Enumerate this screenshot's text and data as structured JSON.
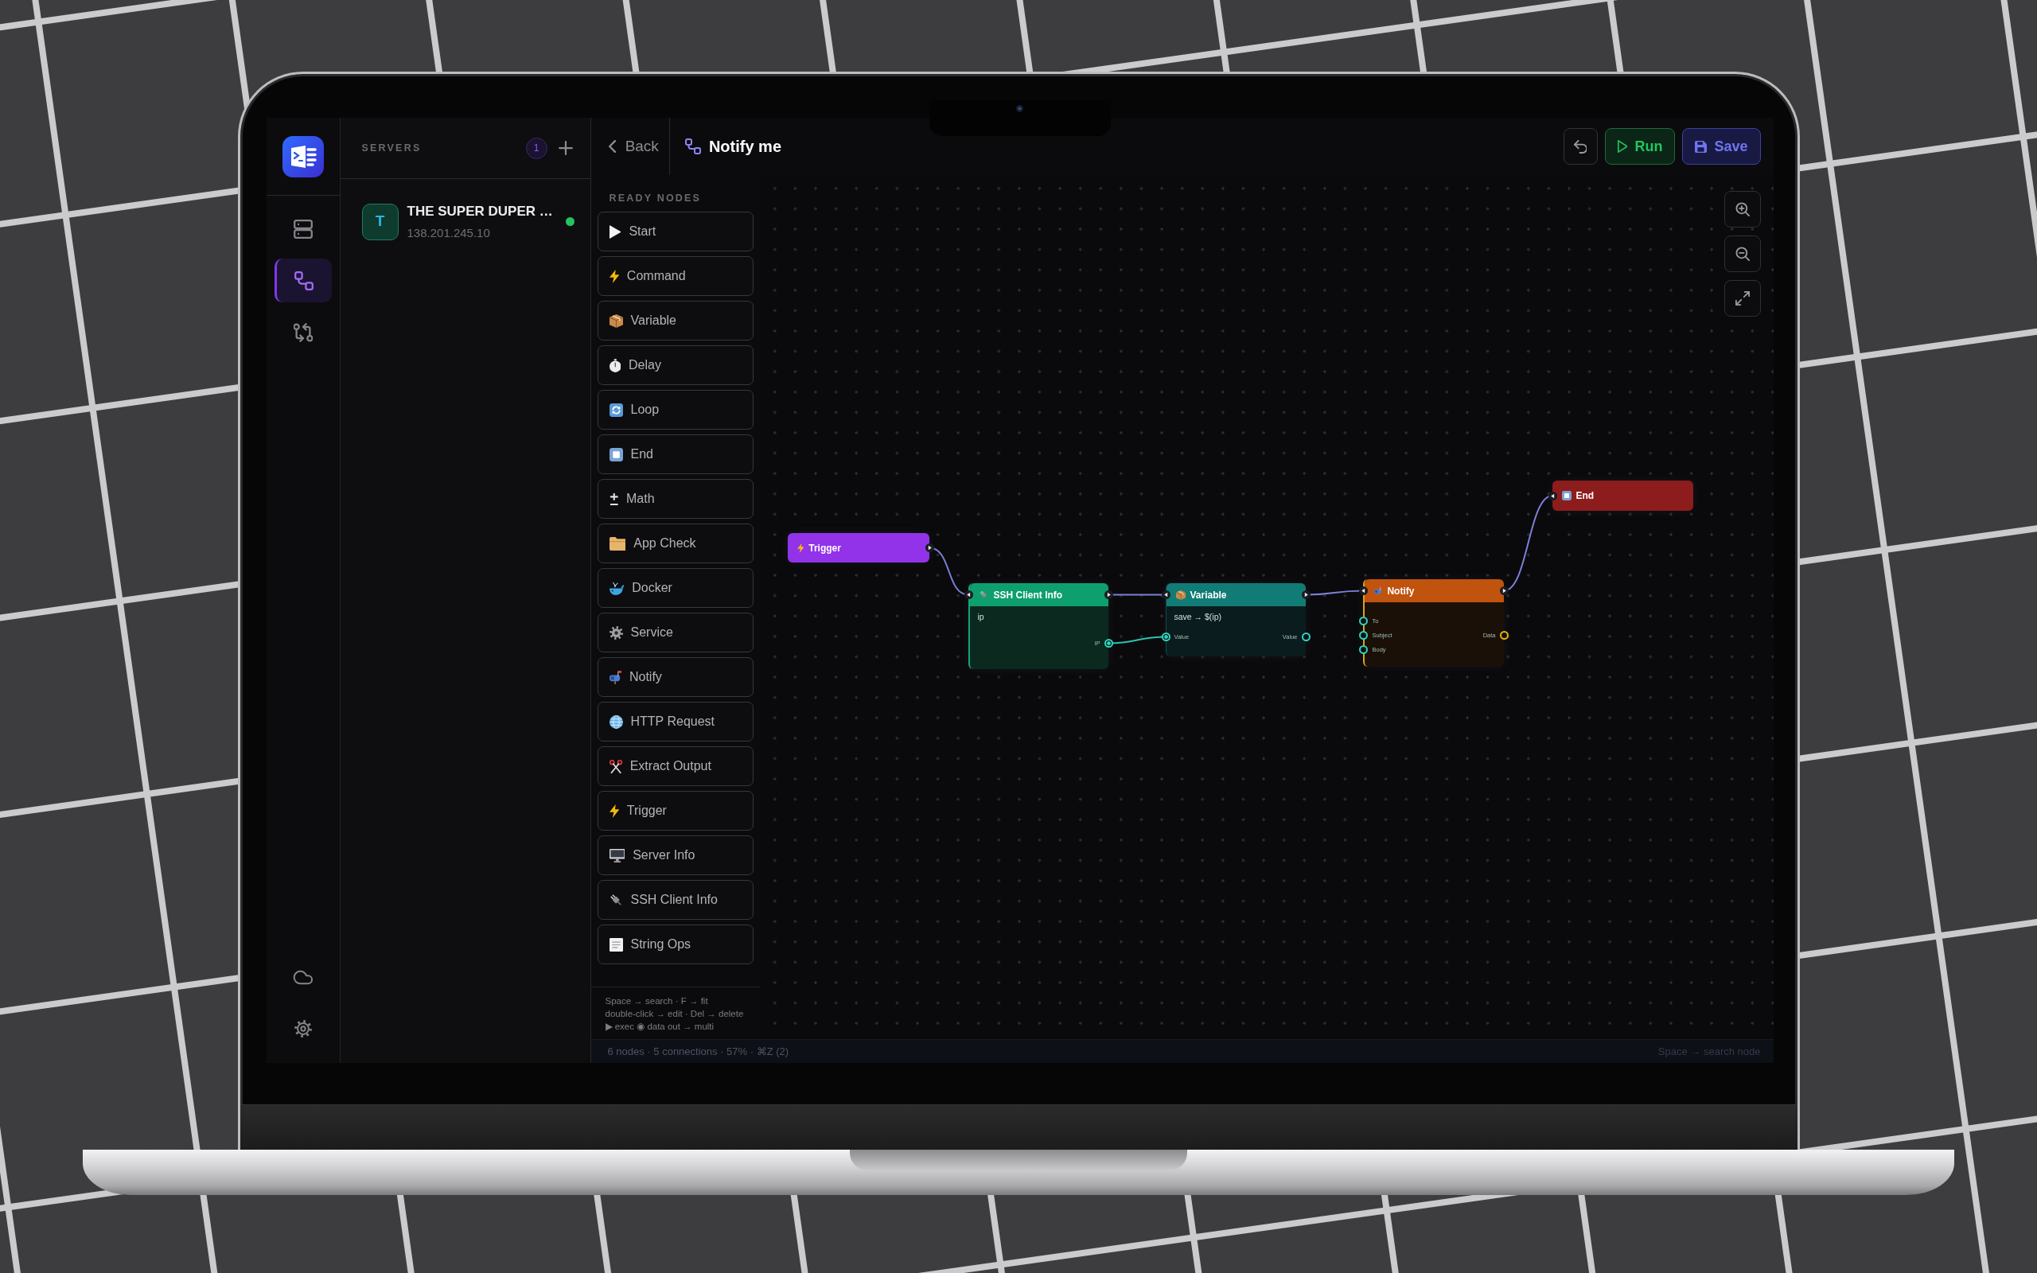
{
  "rail": {
    "items": [
      {
        "kind": "servers",
        "selected": false
      },
      {
        "kind": "workflows",
        "selected": true
      },
      {
        "kind": "compare",
        "selected": false
      }
    ]
  },
  "servers": {
    "title": "SERVERS",
    "count": "1",
    "items": [
      {
        "avatar": "T",
        "name": "THE SUPER DUPER …",
        "ip": "138.201.245.10",
        "online": true
      }
    ]
  },
  "header": {
    "back": "Back",
    "title": "Notify me"
  },
  "toolbar": [
    {
      "kind": "undo"
    },
    {
      "kind": "run",
      "label": "Run"
    },
    {
      "kind": "save",
      "label": "Save"
    }
  ],
  "ready_nodes": {
    "title": "READY NODES",
    "items": [
      {
        "kind": "play",
        "label": "Start"
      },
      {
        "kind": "bolt",
        "label": "Command"
      },
      {
        "kind": "package",
        "label": "Variable"
      },
      {
        "kind": "stopwatch",
        "label": "Delay"
      },
      {
        "kind": "loop",
        "label": "Loop"
      },
      {
        "kind": "stop",
        "label": "End"
      },
      {
        "kind": "plusminus",
        "label": "Math"
      },
      {
        "kind": "folder",
        "label": "App Check"
      },
      {
        "kind": "whale",
        "label": "Docker"
      },
      {
        "kind": "gear",
        "label": "Service"
      },
      {
        "kind": "mailbox",
        "label": "Notify"
      },
      {
        "kind": "globe",
        "label": "HTTP Request"
      },
      {
        "kind": "scissors",
        "label": "Extract Output"
      },
      {
        "kind": "bolt",
        "label": "Trigger"
      },
      {
        "kind": "monitor",
        "label": "Server Info"
      },
      {
        "kind": "plug",
        "label": "SSH Client Info"
      },
      {
        "kind": "memo",
        "label": "String Ops"
      }
    ],
    "hints": [
      "Space → search · F → fit",
      "double-click → edit · Del → delete",
      "▶ exec ◉ data out → multi"
    ]
  },
  "canvas": {
    "nodes": [
      {
        "kind": "trigger",
        "title": "Trigger"
      },
      {
        "kind": "ssh",
        "title": "SSH Client Info",
        "text": "ip",
        "outputs": [
          {
            "label": "IP",
            "color": "#2dd4bf",
            "connected": true
          }
        ]
      },
      {
        "kind": "variable",
        "title": "Variable",
        "text": "save → $(ip)",
        "inputs": [
          {
            "label": "Value",
            "color": "#2dd4bf",
            "connected": true
          }
        ],
        "outputs": [
          {
            "label": "Value",
            "color": "#2dd4bf",
            "connected": false
          }
        ]
      },
      {
        "kind": "notify",
        "title": "Notify",
        "inputs": [
          {
            "label": "To",
            "color": "#2dd4bf",
            "connected": false
          },
          {
            "label": "Subject",
            "color": "#2dd4bf",
            "connected": false
          },
          {
            "label": "Body",
            "color": "#2dd4bf",
            "connected": false
          }
        ],
        "outputs": [
          {
            "label": "Data",
            "color": "#eab308",
            "connected": false
          }
        ]
      },
      {
        "kind": "end",
        "title": "End"
      }
    ]
  },
  "status_bar": {
    "summary": "6 nodes · 5 connections · 57% · ⌘Z (2)",
    "hint": "Space → search node"
  }
}
